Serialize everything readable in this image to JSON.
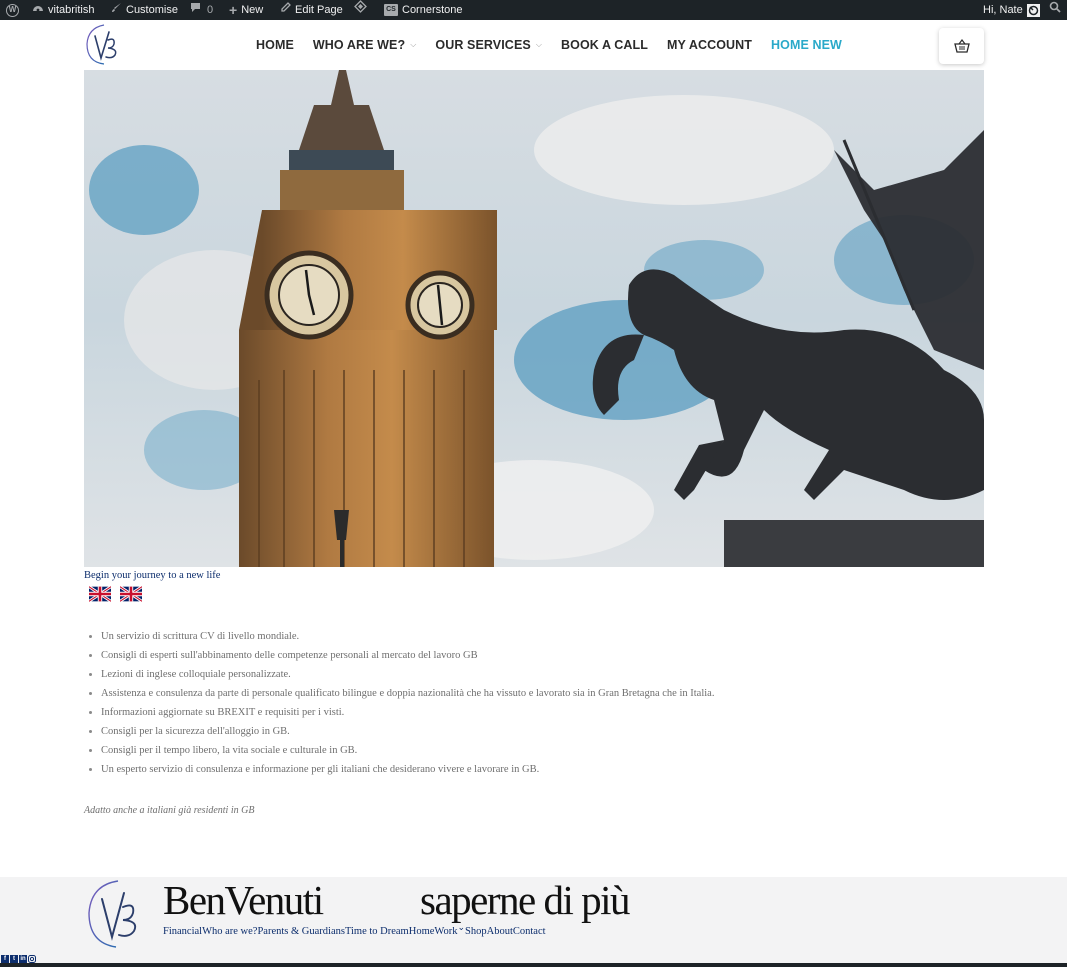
{
  "admin_bar": {
    "site_name": "vitabritish",
    "customise": "Customise",
    "comments_count": "0",
    "new": "New",
    "edit_page": "Edit Page",
    "cornerstone": "Cornerstone",
    "greeting": "Hi, Nate"
  },
  "header": {
    "nav": [
      {
        "label": "HOME",
        "dropdown": false
      },
      {
        "label": "WHO ARE WE?",
        "dropdown": true
      },
      {
        "label": "OUR SERVICES",
        "dropdown": true
      },
      {
        "label": "BOOK A CALL",
        "dropdown": false
      },
      {
        "label": "MY ACCOUNT",
        "dropdown": false
      },
      {
        "label": "HOME NEW",
        "dropdown": false,
        "active": true
      }
    ],
    "active_color": "#2aa9c9"
  },
  "main": {
    "tagline": "Begin your journey to a new life",
    "benefits": [
      "Un servizio di scrittura CV di livello mondiale.",
      "Consigli di esperti sull'abbinamento delle competenze personali al mercato del lavoro GB",
      "Lezioni di inglese colloquiale personalizzate.",
      "Assistenza e consulenza da parte di personale qualificato bilingue e doppia nazionalità che ha vissuto e lavorato sia in Gran Bretagna che in Italia.",
      "Informazioni aggiornate su BREXIT e requisiti per i visti.",
      "Consigli per la sicurezza dell'alloggio in GB.",
      "Consigli per il tempo libero, la vita sociale e culturale in GB.",
      "Un esperto servizio di consulenza e informazione per gli italiani che desiderano vivere e lavorare in GB."
    ],
    "note": "Adatto anche a italiani già residenti in GB"
  },
  "footer": {
    "title_left": "BenVenuti",
    "title_right": "saperne di più",
    "nav": [
      "Financial",
      "Who are we?",
      "Parents & Guardians",
      "Time to Dream",
      "Home",
      "Work",
      "Shop",
      "About",
      "Contact"
    ],
    "work_dropdown": "⌄"
  },
  "colors": {
    "admin_bar": "#1d2327",
    "link_navy": "#0d2e6d",
    "footer_bg": "#f3f3f4"
  }
}
